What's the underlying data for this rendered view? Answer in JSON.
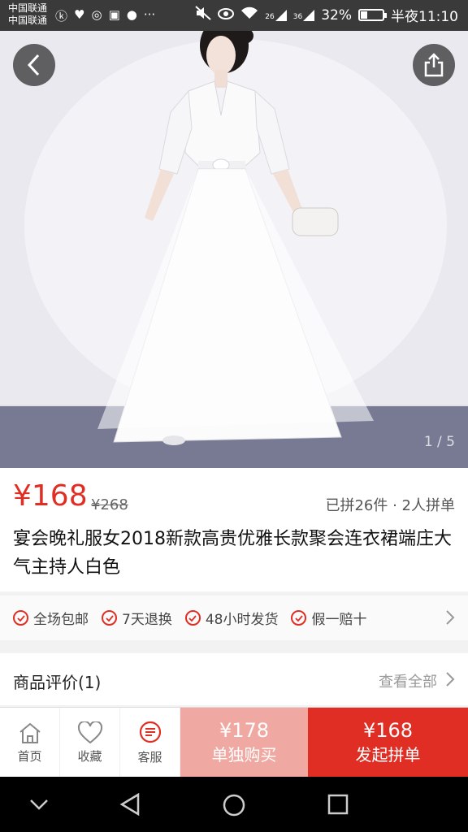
{
  "status_bar": {
    "carrier1": "中国联通",
    "carrier2": "中国联通",
    "signal1": "26",
    "signal2": "36",
    "battery": "32%",
    "battery_level": 0.32,
    "time": "半夜11:10"
  },
  "hero": {
    "image_counter": "1 / 5"
  },
  "product": {
    "price": "¥168",
    "original_price": "¥268",
    "group_stats": "已拼26件 · 2人拼单",
    "title": "宴会晚礼服女2018新款高贵优雅长款聚会连衣裙端庄大气主持人白色"
  },
  "guarantees": [
    "全场包邮",
    "7天退换",
    "48小时发货",
    "假一赔十"
  ],
  "reviews": {
    "title": "商品评价(1)",
    "view_all": "查看全部"
  },
  "bottom_bar": {
    "home": "首页",
    "favorite": "收藏",
    "service": "客服",
    "buy_alone_price": "¥178",
    "buy_alone_label": "单独购买",
    "buy_group_price": "¥168",
    "buy_group_label": "发起拼单"
  },
  "colors": {
    "accent": "#e02e24",
    "accent_light": "#f0a9a2"
  }
}
